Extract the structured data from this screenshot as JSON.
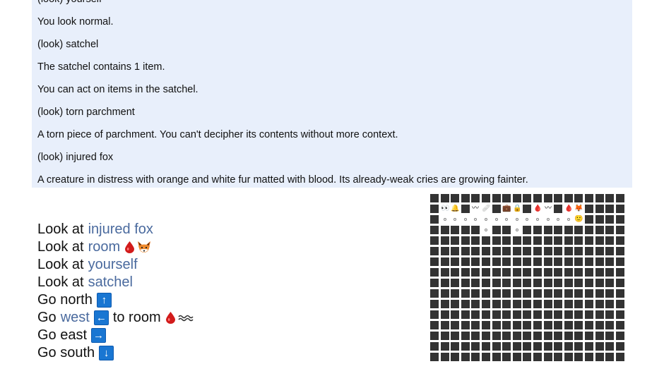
{
  "log": {
    "lines": [
      "(look) yourself",
      "You look normal.",
      "(look) satchel",
      "The satchel contains 1 item.",
      "You can act on items in the satchel.",
      "(look) torn parchment",
      "A torn piece of parchment. You can't decipher its contents without more context.",
      "(look) injured fox",
      "A creature in distress with orange and white fur matted with blood. Its already-weak cries are growing fainter."
    ]
  },
  "actions": [
    {
      "verb": "Look at",
      "target": "injured fox"
    },
    {
      "verb": "Look at",
      "target": "room",
      "icons": [
        "blood-drop-icon",
        "fox-icon"
      ]
    },
    {
      "verb": "Look at",
      "target": "yourself"
    },
    {
      "verb": "Look at",
      "target": "satchel"
    },
    {
      "verb": "Go north",
      "arrow": "↑"
    },
    {
      "verb": "Go",
      "target": "west",
      "arrow": "←",
      "suffix": "to room",
      "icons": [
        "blood-drop-icon",
        "wave-icon"
      ]
    },
    {
      "verb": "Go east",
      "arrow": "→"
    },
    {
      "verb": "Go south",
      "arrow": "↓"
    }
  ],
  "minimap": {
    "row1_icons": [
      "👀",
      "🔔",
      "",
      "〰",
      "🩹",
      "",
      "💼",
      "🔒",
      "",
      "🩸",
      "〰",
      "",
      "🩸",
      "🦊"
    ],
    "row2_icon": "🙂"
  }
}
